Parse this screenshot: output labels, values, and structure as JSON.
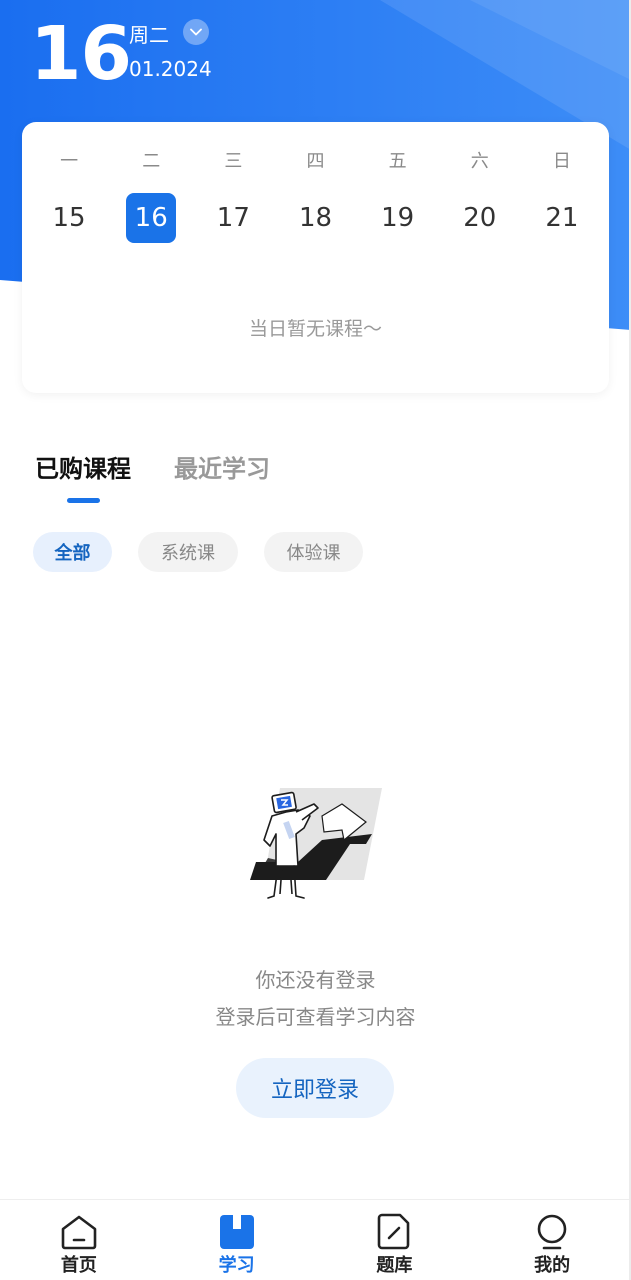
{
  "header": {
    "day": "16",
    "weekday": "周二",
    "month_year": "01.2024",
    "toggle_icon": "chevron-down-icon"
  },
  "calendar": {
    "weekdays": [
      "一",
      "二",
      "三",
      "四",
      "五",
      "六",
      "日"
    ],
    "dates": [
      "15",
      "16",
      "17",
      "18",
      "19",
      "20",
      "21"
    ],
    "selected_index": 1,
    "empty_text": "当日暂无课程～"
  },
  "tabs": {
    "purchased": "已购课程",
    "recent": "最近学习",
    "active": "purchased"
  },
  "filters": {
    "all": "全部",
    "system": "系统课",
    "trial": "体验课",
    "active": "all"
  },
  "empty_state": {
    "title": "你还没有登录",
    "subtitle": "登录后可查看学习内容",
    "login_button": "立即登录"
  },
  "bottom_nav": {
    "items": [
      {
        "label": "首页",
        "icon": "home-icon"
      },
      {
        "label": "学习",
        "icon": "book-icon"
      },
      {
        "label": "题库",
        "icon": "edit-icon"
      },
      {
        "label": "我的",
        "icon": "profile-icon"
      }
    ],
    "active_index": 1
  },
  "colors": {
    "brand_blue": "#1a73e8",
    "chip_active_bg": "#e7f0fd",
    "chip_active_text": "#1565c0"
  }
}
